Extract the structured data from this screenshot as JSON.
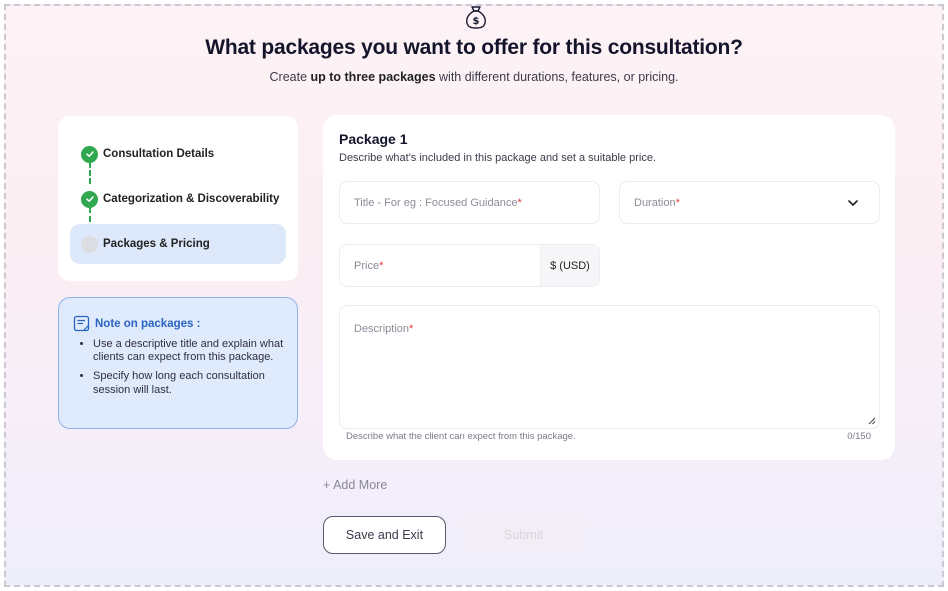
{
  "header": {
    "icon": "money-bag-icon",
    "title": "What packages you want to offer for this consultation?",
    "subtitle_pre": "Create ",
    "subtitle_bold": "up to three packages",
    "subtitle_post": " with different durations, features, or pricing."
  },
  "steps": [
    {
      "label": "Consultation Details",
      "status": "completed"
    },
    {
      "label": "Categorization & Discoverability",
      "status": "completed"
    },
    {
      "label": "Packages & Pricing",
      "status": "active"
    }
  ],
  "note": {
    "icon": "note-icon",
    "title": "Note on packages :",
    "items": [
      "Use a descriptive title and explain what clients can expect from this package.",
      "Specify how long each consultation session will last."
    ]
  },
  "package": {
    "heading": "Package 1",
    "description": "Describe what's included in this package and set a suitable price.",
    "title_placeholder": "Title - For eg : Focused Guidance",
    "duration_placeholder": "Duration",
    "price_placeholder": "Price",
    "currency": "$ (USD)",
    "description_placeholder": "Description",
    "required_mark": "*",
    "description_help": "Describe what the client can expect from this package.",
    "description_count": "0/150"
  },
  "actions": {
    "add_more": "+ Add More",
    "save_exit": "Save and Exit",
    "submit": "Submit"
  },
  "colors": {
    "accent": "#2a63c4",
    "success": "#2fa84f",
    "required": "#e53935"
  }
}
